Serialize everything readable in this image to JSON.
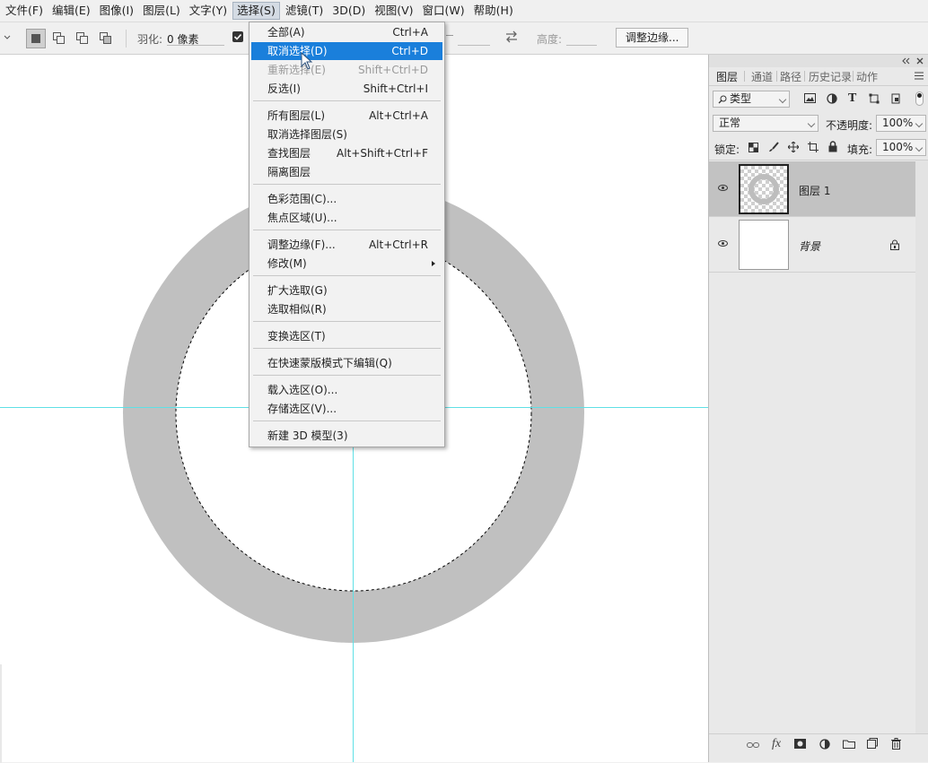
{
  "menubar": {
    "items": [
      "文件(F)",
      "编辑(E)",
      "图像(I)",
      "图层(L)",
      "文字(Y)",
      "选择(S)",
      "滤镜(T)",
      "3D(D)",
      "视图(V)",
      "窗口(W)",
      "帮助(H)"
    ],
    "open_index": 5
  },
  "options": {
    "feather_label": "羽化:",
    "feather_value": "0 像素",
    "height_label": "高度:",
    "refine_button": "调整边缘..."
  },
  "select_menu": {
    "items": [
      {
        "label": "全部(A)",
        "shortcut": "Ctrl+A"
      },
      {
        "label": "取消选择(D)",
        "shortcut": "Ctrl+D",
        "highlighted": true
      },
      {
        "label": "重新选择(E)",
        "shortcut": "Shift+Ctrl+D",
        "disabled": true
      },
      {
        "label": "反选(I)",
        "shortcut": "Shift+Ctrl+I"
      },
      {
        "label": "所有图层(L)",
        "shortcut": "Alt+Ctrl+A"
      },
      {
        "label": "取消选择图层(S)",
        "shortcut": ""
      },
      {
        "label": "查找图层",
        "shortcut": "Alt+Shift+Ctrl+F"
      },
      {
        "label": "隔离图层",
        "shortcut": ""
      },
      {
        "label": "色彩范围(C)...",
        "shortcut": ""
      },
      {
        "label": "焦点区域(U)...",
        "shortcut": ""
      },
      {
        "label": "调整边缘(F)...",
        "shortcut": "Alt+Ctrl+R"
      },
      {
        "label": "修改(M)",
        "shortcut": "",
        "submenu": true
      },
      {
        "label": "扩大选取(G)",
        "shortcut": ""
      },
      {
        "label": "选取相似(R)",
        "shortcut": ""
      },
      {
        "label": "变换选区(T)",
        "shortcut": ""
      },
      {
        "label": "在快速蒙版模式下编辑(Q)",
        "shortcut": ""
      },
      {
        "label": "载入选区(O)...",
        "shortcut": ""
      },
      {
        "label": "存储选区(V)...",
        "shortcut": ""
      },
      {
        "label": "新建 3D 模型(3)",
        "shortcut": ""
      }
    ]
  },
  "layers_panel": {
    "tabs": [
      "图层",
      "通道",
      "路径",
      "历史记录",
      "动作"
    ],
    "filter_label": "类型",
    "blend_mode": "正常",
    "opacity_label": "不透明度:",
    "opacity_value": "100%",
    "lock_label": "锁定:",
    "fill_label": "填充:",
    "fill_value": "100%",
    "layers": [
      {
        "name": "图层 1",
        "selected": true
      },
      {
        "name": "背景",
        "locked": true
      }
    ]
  },
  "colors": {
    "ring": "#c0c0c0",
    "guide": "#5fe0e6",
    "menu_highlight": "#1a7fdb"
  }
}
